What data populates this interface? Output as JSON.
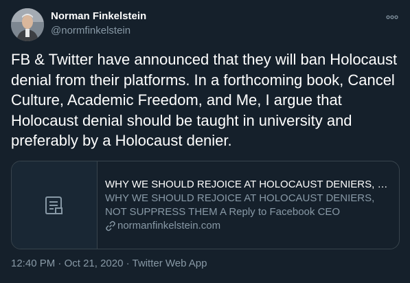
{
  "author": {
    "display_name": "Norman Finkelstein",
    "handle": "@normfinkelstein"
  },
  "tweet": {
    "text": "FB & Twitter have announced that they will ban Holocaust denial from their platforms.  In a forthcoming book, Cancel Culture, Academic Freedom, and Me, I argue that Holocaust denial should be taught in university and preferably by a Holocaust denier."
  },
  "card": {
    "title": "WHY WE SHOULD REJOICE AT HOLOCAUST DENIERS, NOT SUPPRESS THEM A Reply to Facebook CEO",
    "description": "WHY WE SHOULD REJOICE AT HOLOCAUST DENIERS, NOT SUPPRESS THEM A Reply to Facebook CEO",
    "domain": "normanfinkelstein.com",
    "thumb_icon": "document-icon",
    "link_icon": "link-icon"
  },
  "meta": {
    "time": "12:40 PM",
    "separator_1": " · ",
    "date": "Oct 21, 2020",
    "separator_2": " · ",
    "source": "Twitter Web App"
  },
  "icons": {
    "more": "more-options-icon"
  },
  "colors": {
    "background": "#15202b",
    "secondary_text": "#8899a6",
    "border": "#38444d",
    "card_thumb": "#192734"
  }
}
